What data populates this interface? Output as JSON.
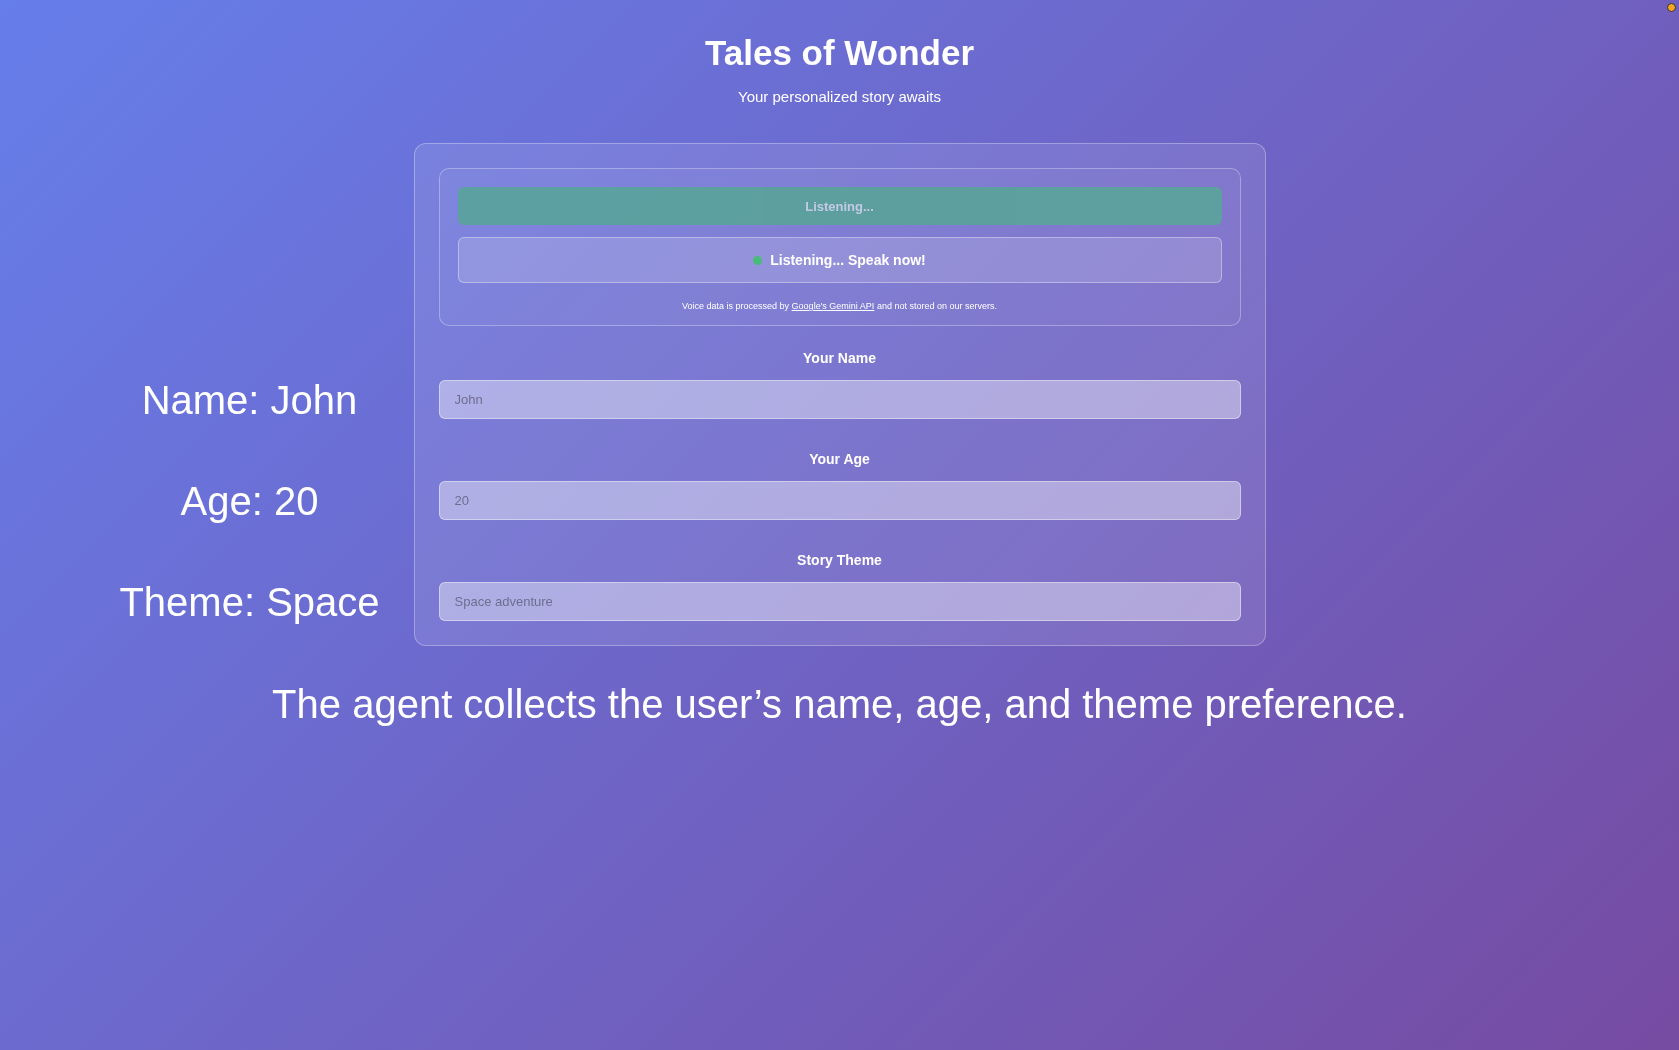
{
  "header": {
    "title": "Tales of Wonder",
    "subtitle": "Your personalized story awaits"
  },
  "voice_panel": {
    "button": {
      "label": "Listening...",
      "disabled": true
    },
    "status": {
      "text": "Listening... Speak now!",
      "active": true
    },
    "notice": {
      "before": "Voice data is processed by",
      "link": "Google's Gemini API",
      "after": "and not stored on our servers."
    }
  },
  "fields": [
    {
      "label": "Your Name",
      "placeholder": "John",
      "annotation": "Name: John"
    },
    {
      "label": "Your Age",
      "placeholder": "20",
      "annotation": "Age: 20"
    },
    {
      "label": "Story Theme",
      "placeholder": "Space adventure",
      "annotation": "Theme: Space"
    }
  ],
  "caption": "The agent collects the user’s name, age, and theme preference."
}
